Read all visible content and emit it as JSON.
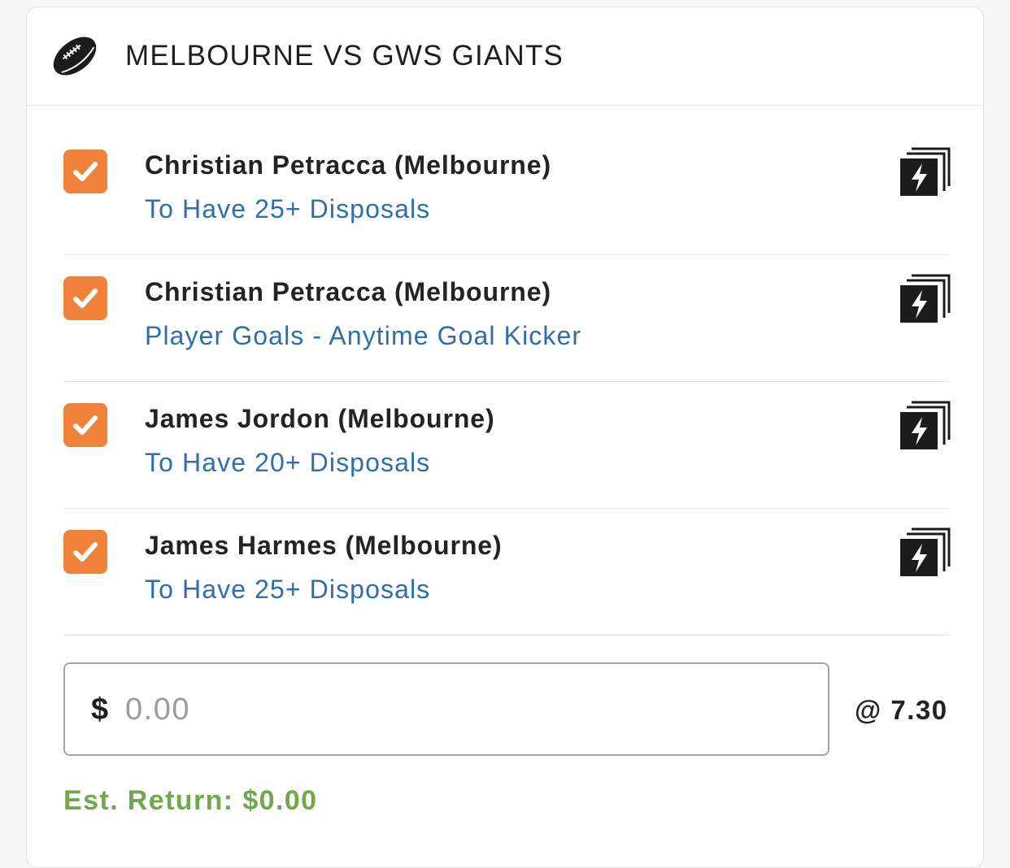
{
  "header": {
    "title": "MELBOURNE VS GWS GIANTS",
    "icon": "football-icon"
  },
  "legs": [
    {
      "checked": true,
      "player": "Christian Petracca (Melbourne)",
      "market": "To Have 25+ Disposals",
      "icon": "same-game-multi-icon"
    },
    {
      "checked": true,
      "player": "Christian Petracca (Melbourne)",
      "market": "Player Goals - Anytime Goal Kicker",
      "icon": "same-game-multi-icon"
    },
    {
      "checked": true,
      "player": "James Jordon (Melbourne)",
      "market": "To Have 20+ Disposals",
      "icon": "same-game-multi-icon"
    },
    {
      "checked": true,
      "player": "James Harmes (Melbourne)",
      "market": "To Have 25+ Disposals",
      "icon": "same-game-multi-icon"
    }
  ],
  "stake": {
    "currency": "$",
    "value": "",
    "placeholder": "0.00"
  },
  "odds": "@ 7.30",
  "est_return": "Est. Return: $0.00",
  "colors": {
    "checkbox": "#f0823a",
    "market_link": "#2a6fb6",
    "est_return": "#71a84a"
  }
}
